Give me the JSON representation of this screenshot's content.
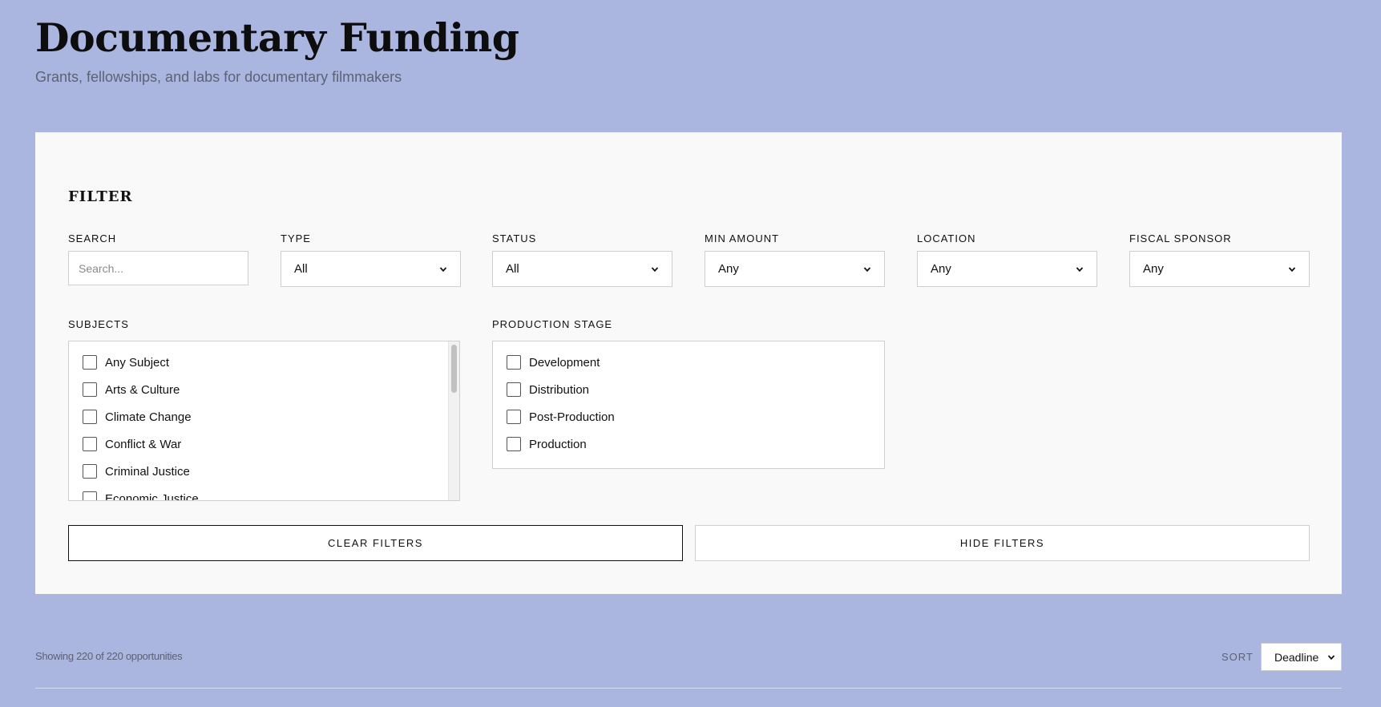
{
  "header": {
    "title": "Documentary Funding",
    "subtitle": "Grants, fellowships, and labs for documentary filmmakers"
  },
  "filter": {
    "heading": "FILTER",
    "search": {
      "label": "SEARCH",
      "placeholder": "Search...",
      "value": ""
    },
    "type": {
      "label": "TYPE",
      "value": "All"
    },
    "status": {
      "label": "STATUS",
      "value": "All"
    },
    "min_amount": {
      "label": "MIN AMOUNT",
      "value": "Any"
    },
    "location": {
      "label": "LOCATION",
      "value": "Any"
    },
    "fiscal_sponsor": {
      "label": "FISCAL SPONSOR",
      "value": "Any"
    },
    "subjects": {
      "label": "SUBJECTS",
      "options": [
        "Any Subject",
        "Arts & Culture",
        "Climate Change",
        "Conflict & War",
        "Criminal Justice",
        "Economic Justice"
      ]
    },
    "production_stage": {
      "label": "PRODUCTION STAGE",
      "options": [
        "Development",
        "Distribution",
        "Post-Production",
        "Production"
      ]
    },
    "clear_label": "CLEAR FILTERS",
    "hide_label": "HIDE FILTERS"
  },
  "results": {
    "count_text": "Showing 220 of 220 opportunities",
    "sort_label": "SORT",
    "sort_value": "Deadline"
  },
  "icons": {
    "select_arrow": "chevron-down-icon"
  }
}
